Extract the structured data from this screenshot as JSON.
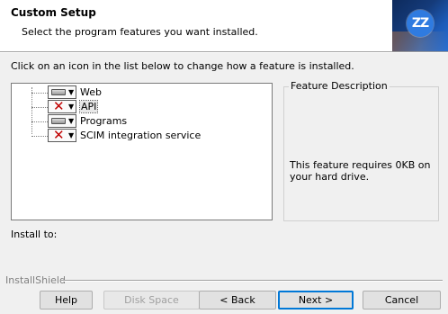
{
  "header": {
    "title": "Custom Setup",
    "subtitle": "Select the program features you want installed.",
    "logo_text": "ZZ"
  },
  "instruction": "Click on an icon in the list below to change how a feature is installed.",
  "features": [
    {
      "label": "Web",
      "state": "install",
      "icon": "hard-drive-icon"
    },
    {
      "label": "API",
      "state": "unavailable",
      "icon": "red-x-icon"
    },
    {
      "label": "Programs",
      "state": "install",
      "icon": "hard-drive-icon"
    },
    {
      "label": "SCIM integration service",
      "state": "unavailable",
      "icon": "red-x-icon"
    }
  ],
  "description": {
    "legend": "Feature Description",
    "text": "This feature requires 0KB on your hard drive."
  },
  "install_to": "Install to:",
  "installshield": "InstallShield",
  "buttons": {
    "help": "Help",
    "disk_space": "Disk Space",
    "back": "< Back",
    "next": "Next >",
    "cancel": "Cancel"
  },
  "colors": {
    "accent": "#0078d7",
    "x_mark": "#c00000",
    "logo_bg": "#2f7be0"
  }
}
